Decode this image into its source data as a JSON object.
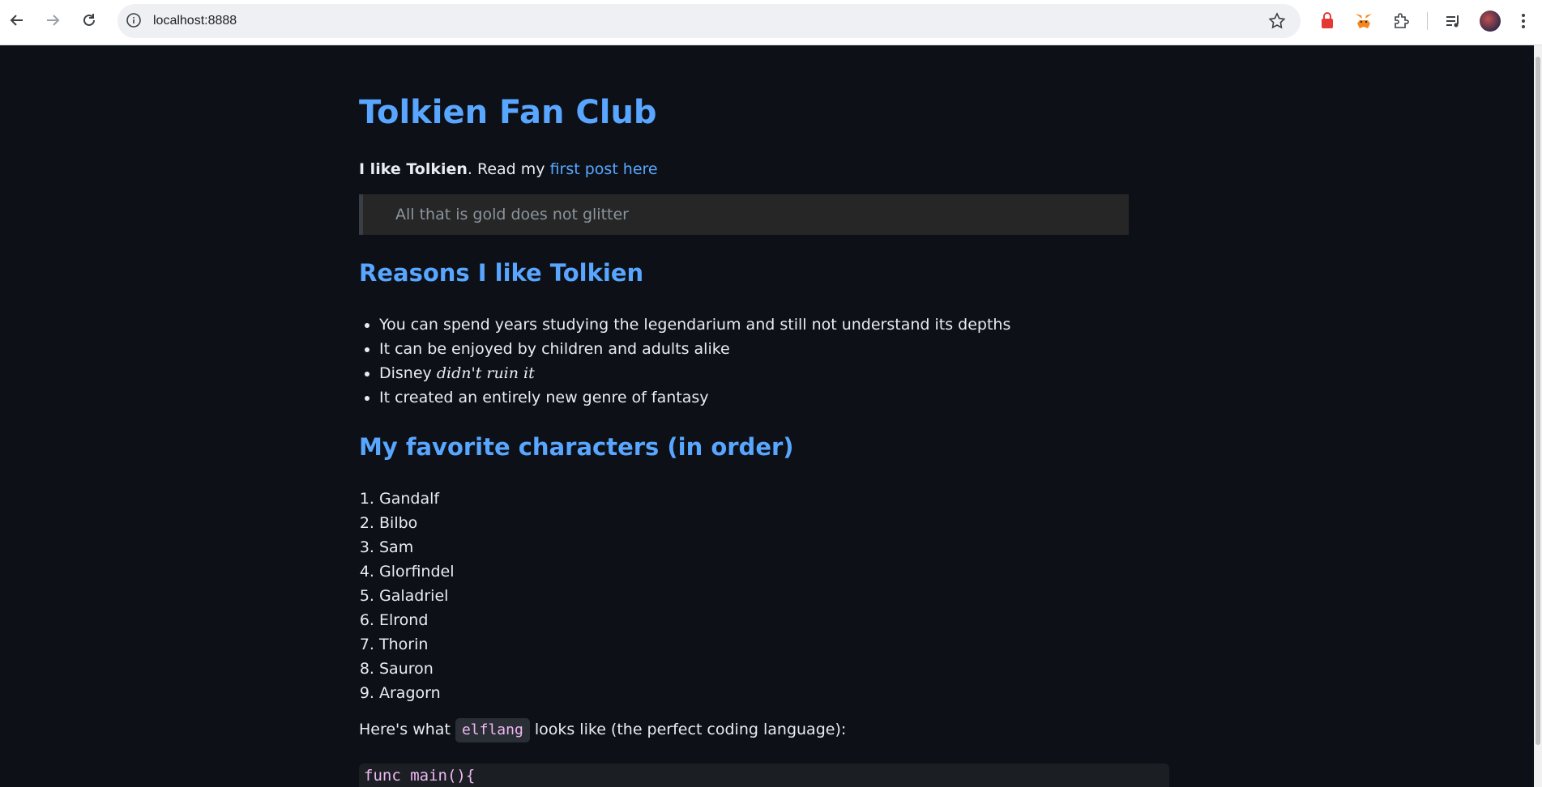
{
  "browser": {
    "url": "localhost:8888"
  },
  "page": {
    "title": "Tolkien Fan Club",
    "intro": {
      "bold": "I like Tolkien",
      "text": ". Read my ",
      "link": "first post here"
    },
    "quote": "All that is gold does not glitter",
    "reasons_heading": "Reasons I like Tolkien",
    "reasons": [
      "You can spend years studying the legendarium and still not understand its depths",
      "It can be enjoyed by children and adults alike",
      "It created an entirely new genre of fantasy"
    ],
    "reason_disney": {
      "prefix": "Disney ",
      "italic": "didn't ruin it"
    },
    "characters_heading": "My favorite characters (in order)",
    "characters": [
      "Gandalf",
      "Bilbo",
      "Sam",
      "Glorfindel",
      "Galadriel",
      "Elrond",
      "Thorin",
      "Sauron",
      "Aragorn"
    ],
    "code_intro": {
      "before": "Here's what ",
      "code": "elflang",
      "after": " looks like (the perfect coding language):"
    },
    "code_first_line": "func main(){"
  }
}
